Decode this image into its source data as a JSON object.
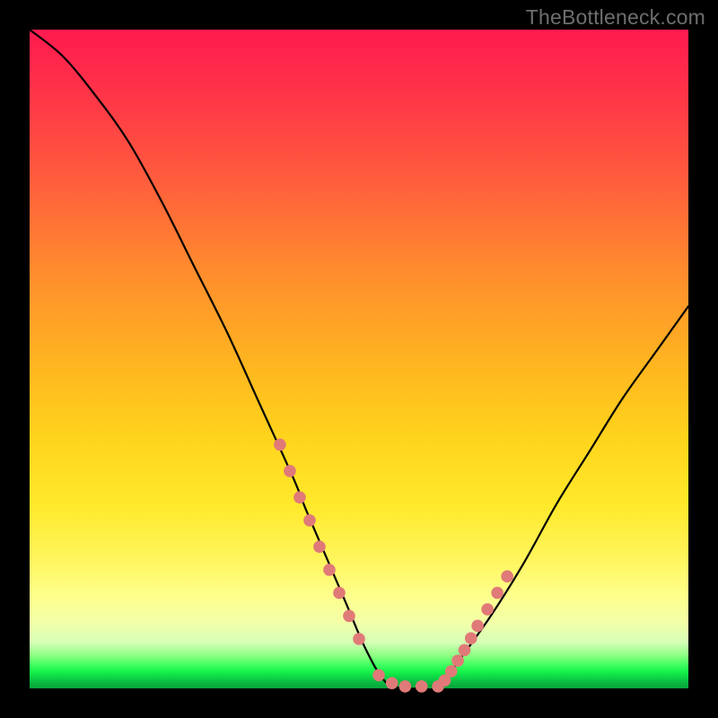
{
  "watermark": "TheBottleneck.com",
  "colors": {
    "background": "#000000",
    "curve": "#000000",
    "dots": "#e07a78",
    "gradient_top": "#ff1a4f",
    "gradient_bottom": "#07a33b"
  },
  "chart_data": {
    "type": "line",
    "title": "",
    "xlabel": "",
    "ylabel": "",
    "xlim": [
      0,
      100
    ],
    "ylim": [
      0,
      100
    ],
    "series": [
      {
        "name": "bottleneck-curve",
        "x": [
          0,
          5,
          10,
          15,
          20,
          25,
          30,
          35,
          40,
          42,
          45,
          48,
          51,
          54,
          57,
          59,
          62,
          65,
          70,
          75,
          80,
          85,
          90,
          95,
          100
        ],
        "y": [
          100,
          96,
          90,
          83,
          74,
          64,
          54,
          43,
          32,
          27,
          20,
          13,
          6,
          1,
          0,
          0,
          0,
          4,
          11,
          19,
          28,
          36,
          44,
          51,
          58
        ]
      }
    ],
    "highlight_points": {
      "name": "highlighted-dots",
      "x": [
        38.0,
        39.5,
        41.0,
        42.5,
        44.0,
        45.5,
        47.0,
        48.5,
        50.0,
        53.0,
        55.0,
        57.0,
        59.5,
        62.0,
        63.0,
        64.0,
        65.0,
        66.0,
        67.0,
        68.0,
        69.5,
        71.0,
        72.5
      ],
      "y": [
        37.0,
        33.0,
        29.0,
        25.5,
        21.5,
        18.0,
        14.5,
        11.0,
        7.5,
        2.0,
        0.8,
        0.3,
        0.3,
        0.3,
        1.2,
        2.6,
        4.2,
        5.8,
        7.6,
        9.5,
        12.0,
        14.5,
        17.0
      ]
    }
  }
}
